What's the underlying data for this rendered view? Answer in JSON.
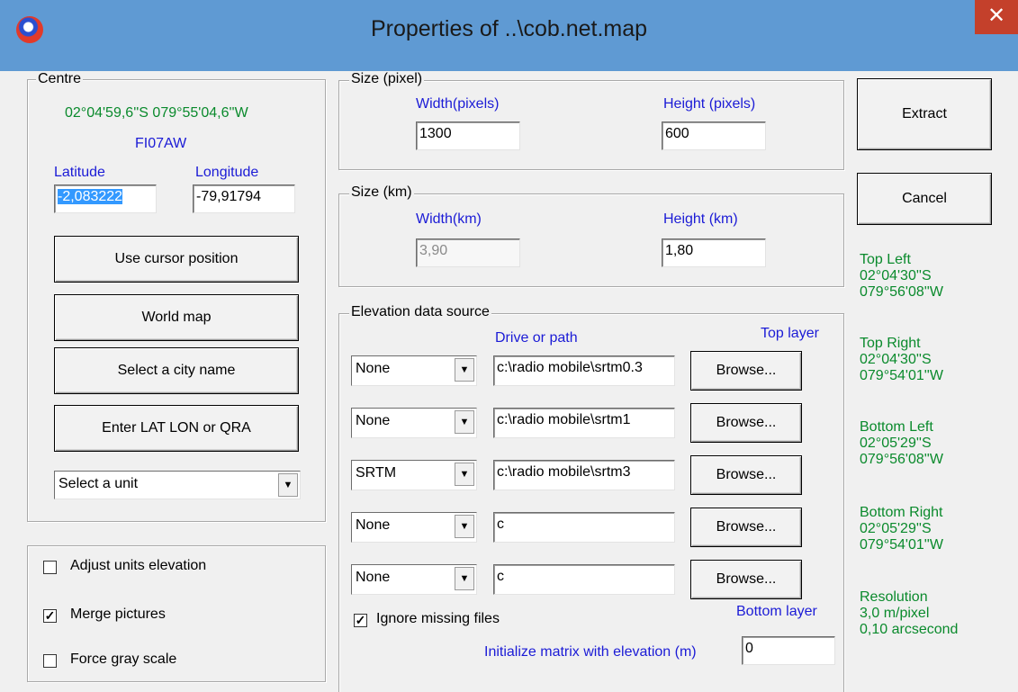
{
  "window": {
    "title": "Properties of ..\\cob.net.map",
    "close_glyph": "✕"
  },
  "centre": {
    "legend": "Centre",
    "coordinate": "02°04'59,6''S 079°55'04,6''W",
    "locator": "FI07AW",
    "latitude_label": "Latitude",
    "longitude_label": "Longitude",
    "latitude_value": "-2,083222",
    "longitude_value": "-79,91794",
    "buttons": {
      "use_cursor": "Use cursor position",
      "world_map": "World map",
      "select_city": "Select a city name",
      "enter_latlon": "Enter LAT LON or QRA"
    },
    "unit_select": "Select a unit"
  },
  "options": {
    "adjust_units": {
      "label": "Adjust units elevation",
      "checked": false
    },
    "merge_pictures": {
      "label": "Merge pictures",
      "checked": true
    },
    "force_gray": {
      "label": "Force gray scale",
      "checked": false
    }
  },
  "size_pixel": {
    "legend": "Size (pixel)",
    "width_label": "Width(pixels)",
    "height_label": "Height (pixels)",
    "width_value": "1300",
    "height_value": "600"
  },
  "size_km": {
    "legend": "Size (km)",
    "width_label": "Width(km)",
    "height_label": "Height (km)",
    "width_value": "3,90",
    "height_value": "1,80"
  },
  "elevation": {
    "legend": "Elevation data source",
    "drive_label": "Drive or path",
    "top_layer_label": "Top layer",
    "bottom_layer_label": "Bottom layer",
    "browse_label": "Browse...",
    "rows": [
      {
        "source": "None",
        "path": "c:\\radio mobile\\srtm0.3"
      },
      {
        "source": "None",
        "path": "c:\\radio mobile\\srtm1"
      },
      {
        "source": "SRTM",
        "path": "c:\\radio mobile\\srtm3"
      },
      {
        "source": "None",
        "path": "c"
      },
      {
        "source": "None",
        "path": "c"
      }
    ],
    "ignore_missing": {
      "label": "Ignore missing files",
      "checked": true
    },
    "init_matrix_label": "Initialize matrix with elevation (m)",
    "init_matrix_value": "0"
  },
  "actions": {
    "extract": "Extract",
    "cancel": "Cancel"
  },
  "corners": {
    "top_left": {
      "label": "Top Left",
      "lat": "02°04'30''S",
      "lon": "079°56'08''W"
    },
    "top_right": {
      "label": "Top Right",
      "lat": "02°04'30''S",
      "lon": "079°54'01''W"
    },
    "bottom_left": {
      "label": "Bottom Left",
      "lat": "02°05'29''S",
      "lon": "079°56'08''W"
    },
    "bottom_right": {
      "label": "Bottom Right",
      "lat": "02°05'29''S",
      "lon": "079°54'01''W"
    },
    "resolution": {
      "label": "Resolution",
      "value1": "3,0 m/pixel",
      "value2": "0,10 arcsecond"
    }
  },
  "colors": {
    "titlebar": "#5f9ad3",
    "close": "#c4402b",
    "label_blue": "#1b1bd6",
    "text_green": "#0a8a2c"
  }
}
